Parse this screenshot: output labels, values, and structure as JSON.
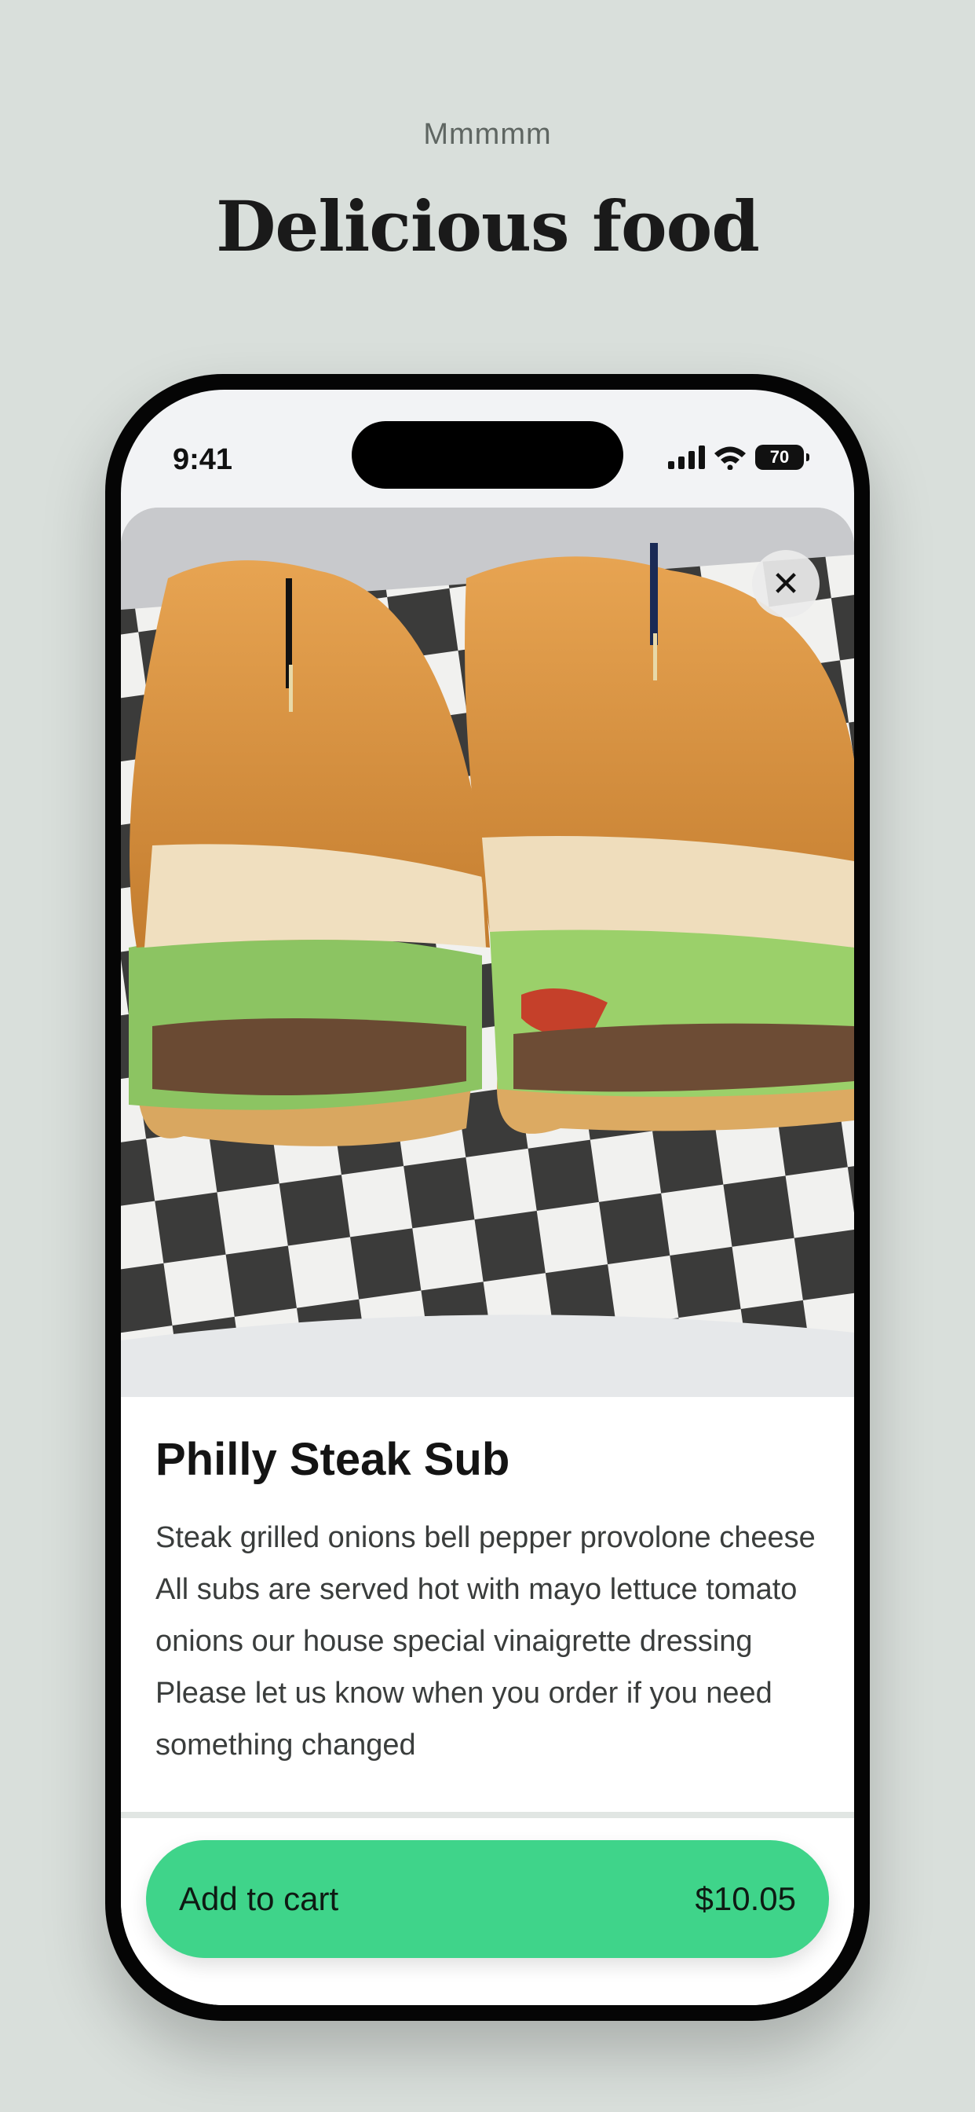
{
  "header": {
    "eyebrow": "Mmmmm",
    "headline": "Delicious food"
  },
  "status_bar": {
    "time": "9:41",
    "battery": "70"
  },
  "item": {
    "title": "Philly Steak Sub",
    "description": "Steak grilled onions bell pepper provolone cheese All subs are served hot with mayo lettuce tomato onions our house special vinaigrette dressing Please let us know when you order if you need something changed",
    "image_icon": "sandwich-photo"
  },
  "close_icon": "close-icon",
  "cart": {
    "label": "Add to cart",
    "price": "$10.05"
  },
  "colors": {
    "background": "#d9dfdb",
    "accent": "#3fd48a"
  }
}
